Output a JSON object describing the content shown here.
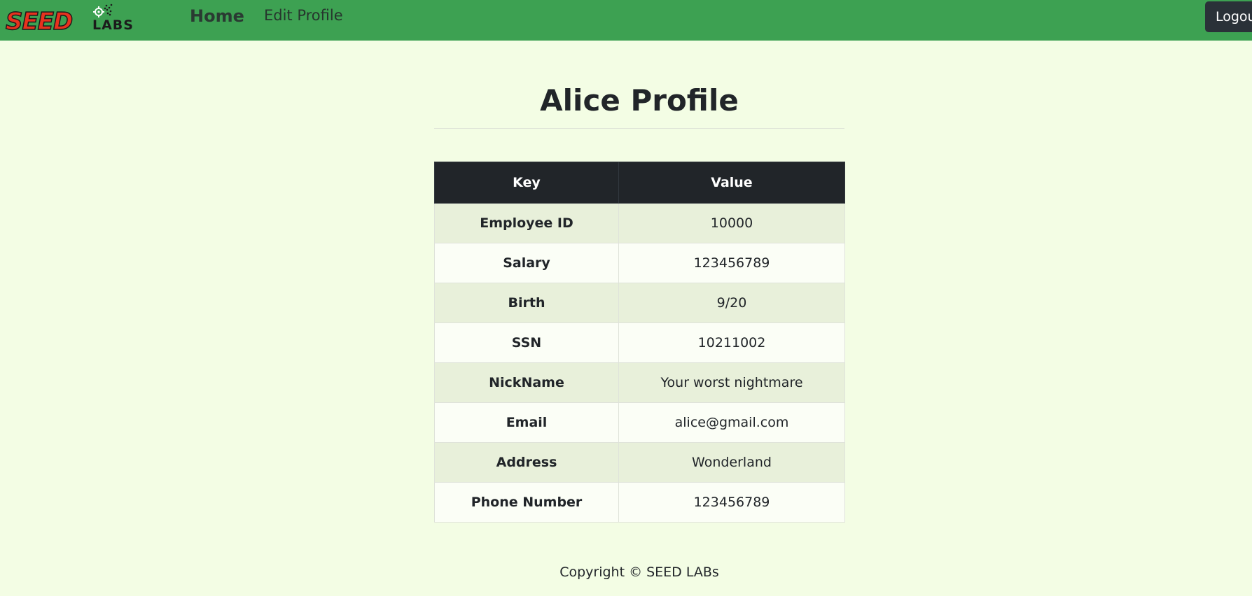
{
  "navbar": {
    "logo": {
      "seed": "SEED",
      "labs": "LABS"
    },
    "home_label": "Home",
    "edit_profile_label": "Edit Profile",
    "logout_label": "Logout",
    "background_color": "#3da152"
  },
  "main": {
    "title": "Alice Profile",
    "table": {
      "columns": [
        "Key",
        "Value"
      ],
      "rows": [
        {
          "key": "Employee ID",
          "value": "10000"
        },
        {
          "key": "Salary",
          "value": "123456789"
        },
        {
          "key": "Birth",
          "value": "9/20"
        },
        {
          "key": "SSN",
          "value": "10211002"
        },
        {
          "key": "NickName",
          "value": "Your worst nightmare"
        },
        {
          "key": "Email",
          "value": "alice@gmail.com"
        },
        {
          "key": "Address",
          "value": "Wonderland"
        },
        {
          "key": "Phone Number",
          "value": "123456789"
        }
      ]
    }
  },
  "footer": {
    "copyright": "Copyright © SEED LABs"
  }
}
